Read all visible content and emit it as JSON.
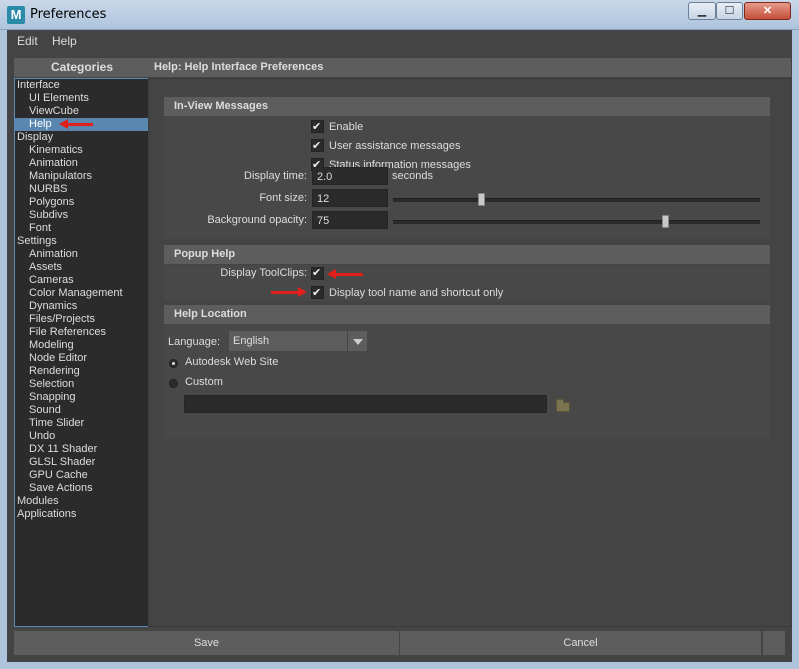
{
  "window": {
    "title": "Preferences",
    "app_icon_letter": "M",
    "minimize": "▁",
    "maximize": "☐",
    "close": "✕"
  },
  "menu": {
    "edit": "Edit",
    "help": "Help"
  },
  "categories": {
    "header": "Categories",
    "items": [
      {
        "label": "Interface",
        "level": 0
      },
      {
        "label": "UI Elements",
        "level": 1
      },
      {
        "label": "ViewCube",
        "level": 1
      },
      {
        "label": "Help",
        "level": 1,
        "selected": true
      },
      {
        "label": "Display",
        "level": 0
      },
      {
        "label": "Kinematics",
        "level": 1
      },
      {
        "label": "Animation",
        "level": 1
      },
      {
        "label": "Manipulators",
        "level": 1
      },
      {
        "label": "NURBS",
        "level": 1
      },
      {
        "label": "Polygons",
        "level": 1
      },
      {
        "label": "Subdivs",
        "level": 1
      },
      {
        "label": "Font",
        "level": 1
      },
      {
        "label": "Settings",
        "level": 0
      },
      {
        "label": "Animation",
        "level": 1
      },
      {
        "label": "Assets",
        "level": 1
      },
      {
        "label": "Cameras",
        "level": 1
      },
      {
        "label": "Color Management",
        "level": 1
      },
      {
        "label": "Dynamics",
        "level": 1
      },
      {
        "label": "Files/Projects",
        "level": 1
      },
      {
        "label": "File References",
        "level": 1
      },
      {
        "label": "Modeling",
        "level": 1
      },
      {
        "label": "Node Editor",
        "level": 1
      },
      {
        "label": "Rendering",
        "level": 1
      },
      {
        "label": "Selection",
        "level": 1
      },
      {
        "label": "Snapping",
        "level": 1
      },
      {
        "label": "Sound",
        "level": 1
      },
      {
        "label": "Time Slider",
        "level": 1
      },
      {
        "label": "Undo",
        "level": 1
      },
      {
        "label": "DX 11 Shader",
        "level": 1
      },
      {
        "label": "GLSL Shader",
        "level": 1
      },
      {
        "label": "GPU Cache",
        "level": 1
      },
      {
        "label": "Save Actions",
        "level": 1
      },
      {
        "label": "Modules",
        "level": 0
      },
      {
        "label": "Applications",
        "level": 0
      }
    ]
  },
  "panel": {
    "header": "Help: Help Interface Preferences",
    "in_view": {
      "title": "In-View Messages",
      "enable": "Enable",
      "user_assistance": "User assistance messages",
      "status_info": "Status information messages",
      "display_time_label": "Display time:",
      "display_time_value": "2.0",
      "display_time_unit": "seconds",
      "font_size_label": "Font size:",
      "font_size_value": "12",
      "font_size_slider": 0.24,
      "bg_opacity_label": "Background opacity:",
      "bg_opacity_value": "75",
      "bg_opacity_slider": 0.74
    },
    "popup": {
      "title": "Popup Help",
      "display_toolclips": "Display ToolClips:",
      "tool_name_shortcut": "Display tool name and shortcut only"
    },
    "location": {
      "title": "Help Location",
      "language_label": "Language:",
      "language_value": "English",
      "web_site": "Autodesk Web Site",
      "custom": "Custom",
      "custom_path": ""
    }
  },
  "buttons": {
    "save": "Save",
    "cancel": "Cancel"
  },
  "colors": {
    "annotation_arrow": "#e1201c",
    "selection": "#5a87b0"
  }
}
